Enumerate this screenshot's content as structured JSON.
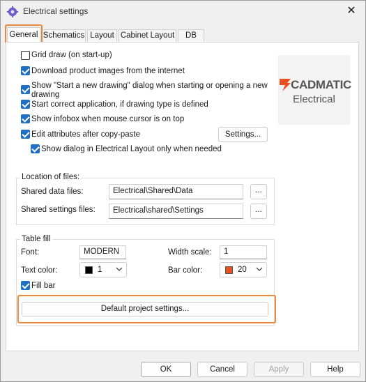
{
  "window": {
    "title": "Electrical settings",
    "close_glyph": "✕",
    "app_icon": "gear-icon"
  },
  "tabs": [
    {
      "label": "General",
      "active": true
    },
    {
      "label": "Schematics",
      "active": false
    },
    {
      "label": "Layout",
      "active": false
    },
    {
      "label": "Cabinet Layout",
      "active": false
    },
    {
      "label": "DB",
      "active": false
    }
  ],
  "general": {
    "options": [
      {
        "label": "Grid draw (on start-up)",
        "checked": false
      },
      {
        "label": "Download product images from the internet",
        "checked": true
      },
      {
        "label_line1": "Show \"Start a new drawing\" dialog when starting or opening a new",
        "label_line2": "drawing",
        "checked": true
      },
      {
        "label": "Start correct application, if drawing type is defined",
        "checked": true
      },
      {
        "label": "Show infobox when mouse cursor is on top",
        "checked": true
      },
      {
        "label": "Edit attributes after copy-paste",
        "checked": true
      },
      {
        "label": "Show dialog in Electrical Layout only when needed",
        "checked": true
      }
    ],
    "settings_button": "Settings...",
    "logo": {
      "brand": "CADMATIC",
      "product": "Electrical",
      "accent": "#e8501f"
    }
  },
  "files": {
    "group_title": "Location of files:",
    "shared_data_label": "Shared data files:",
    "shared_data_value": "Electrical\\Shared\\Data",
    "shared_settings_label": "Shared settings files:",
    "shared_settings_value": "Electrical\\shared\\Settings",
    "browse_label": "..."
  },
  "table_fill": {
    "group_title": "Table fill",
    "font_label": "Font:",
    "font_value": "MODERN",
    "width_scale_label": "Width scale:",
    "width_scale_value": "1",
    "text_color_label": "Text color:",
    "text_color_value": "1",
    "text_color_swatch": "#000000",
    "bar_color_label": "Bar color:",
    "bar_color_value": "20",
    "bar_color_swatch": "#e8501f",
    "fill_bar_label": "Fill bar",
    "fill_bar_checked": true
  },
  "default_project_button": "Default project settings...",
  "footer": {
    "ok": "OK",
    "cancel": "Cancel",
    "apply": "Apply",
    "help": "Help"
  },
  "colors": {
    "accent_highlight": "#e8893b",
    "checkbox_blue": "#1f6fc5"
  }
}
